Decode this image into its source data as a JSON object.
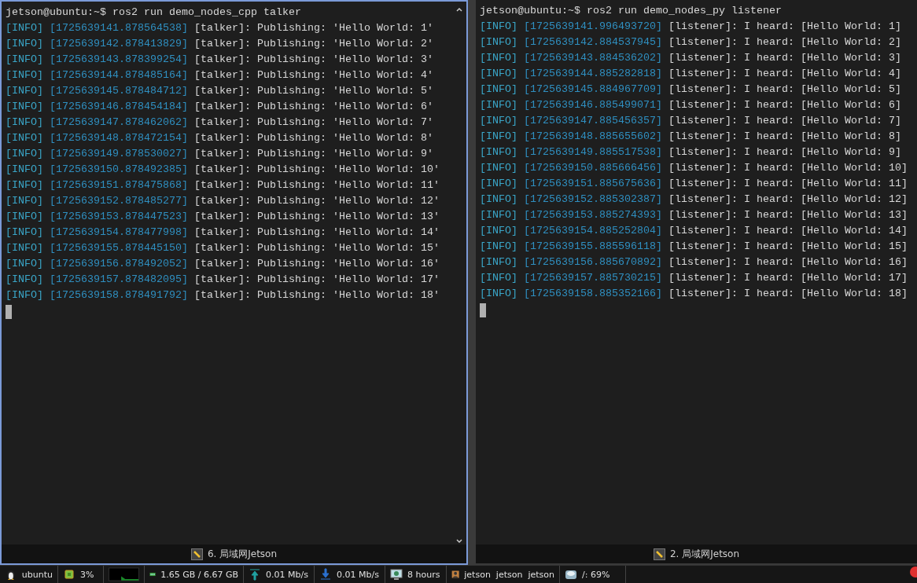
{
  "panes": [
    {
      "active": true,
      "prompt": "jetson@ubuntu:~$ ros2 run demo_nodes_cpp talker",
      "title": "6. 局域网Jetson",
      "lines": [
        {
          "level": "[INFO]",
          "timestamp": "[1725639141.878564538]",
          "message": "[talker]: Publishing: 'Hello World: 1'"
        },
        {
          "level": "[INFO]",
          "timestamp": "[1725639142.878413829]",
          "message": "[talker]: Publishing: 'Hello World: 2'"
        },
        {
          "level": "[INFO]",
          "timestamp": "[1725639143.878399254]",
          "message": "[talker]: Publishing: 'Hello World: 3'"
        },
        {
          "level": "[INFO]",
          "timestamp": "[1725639144.878485164]",
          "message": "[talker]: Publishing: 'Hello World: 4'"
        },
        {
          "level": "[INFO]",
          "timestamp": "[1725639145.878484712]",
          "message": "[talker]: Publishing: 'Hello World: 5'"
        },
        {
          "level": "[INFO]",
          "timestamp": "[1725639146.878454184]",
          "message": "[talker]: Publishing: 'Hello World: 6'"
        },
        {
          "level": "[INFO]",
          "timestamp": "[1725639147.878462062]",
          "message": "[talker]: Publishing: 'Hello World: 7'"
        },
        {
          "level": "[INFO]",
          "timestamp": "[1725639148.878472154]",
          "message": "[talker]: Publishing: 'Hello World: 8'"
        },
        {
          "level": "[INFO]",
          "timestamp": "[1725639149.878530027]",
          "message": "[talker]: Publishing: 'Hello World: 9'"
        },
        {
          "level": "[INFO]",
          "timestamp": "[1725639150.878492385]",
          "message": "[talker]: Publishing: 'Hello World: 10'"
        },
        {
          "level": "[INFO]",
          "timestamp": "[1725639151.878475868]",
          "message": "[talker]: Publishing: 'Hello World: 11'"
        },
        {
          "level": "[INFO]",
          "timestamp": "[1725639152.878485277]",
          "message": "[talker]: Publishing: 'Hello World: 12'"
        },
        {
          "level": "[INFO]",
          "timestamp": "[1725639153.878447523]",
          "message": "[talker]: Publishing: 'Hello World: 13'"
        },
        {
          "level": "[INFO]",
          "timestamp": "[1725639154.878477998]",
          "message": "[talker]: Publishing: 'Hello World: 14'"
        },
        {
          "level": "[INFO]",
          "timestamp": "[1725639155.878445150]",
          "message": "[talker]: Publishing: 'Hello World: 15'"
        },
        {
          "level": "[INFO]",
          "timestamp": "[1725639156.878492052]",
          "message": "[talker]: Publishing: 'Hello World: 16'"
        },
        {
          "level": "[INFO]",
          "timestamp": "[1725639157.878482095]",
          "message": "[talker]: Publishing: 'Hello World: 17'"
        },
        {
          "level": "[INFO]",
          "timestamp": "[1725639158.878491792]",
          "message": "[talker]: Publishing: 'Hello World: 18'"
        }
      ]
    },
    {
      "active": false,
      "prompt": "jetson@ubuntu:~$ ros2 run demo_nodes_py listener",
      "title": "2. 局域网Jetson",
      "lines": [
        {
          "level": "[INFO]",
          "timestamp": "[1725639141.996493720]",
          "message": "[listener]: I heard: [Hello World: 1]"
        },
        {
          "level": "[INFO]",
          "timestamp": "[1725639142.884537945]",
          "message": "[listener]: I heard: [Hello World: 2]"
        },
        {
          "level": "[INFO]",
          "timestamp": "[1725639143.884536202]",
          "message": "[listener]: I heard: [Hello World: 3]"
        },
        {
          "level": "[INFO]",
          "timestamp": "[1725639144.885282818]",
          "message": "[listener]: I heard: [Hello World: 4]"
        },
        {
          "level": "[INFO]",
          "timestamp": "[1725639145.884967709]",
          "message": "[listener]: I heard: [Hello World: 5]"
        },
        {
          "level": "[INFO]",
          "timestamp": "[1725639146.885499071]",
          "message": "[listener]: I heard: [Hello World: 6]"
        },
        {
          "level": "[INFO]",
          "timestamp": "[1725639147.885456357]",
          "message": "[listener]: I heard: [Hello World: 7]"
        },
        {
          "level": "[INFO]",
          "timestamp": "[1725639148.885655602]",
          "message": "[listener]: I heard: [Hello World: 8]"
        },
        {
          "level": "[INFO]",
          "timestamp": "[1725639149.885517538]",
          "message": "[listener]: I heard: [Hello World: 9]"
        },
        {
          "level": "[INFO]",
          "timestamp": "[1725639150.885666456]",
          "message": "[listener]: I heard: [Hello World: 10]"
        },
        {
          "level": "[INFO]",
          "timestamp": "[1725639151.885675636]",
          "message": "[listener]: I heard: [Hello World: 11]"
        },
        {
          "level": "[INFO]",
          "timestamp": "[1725639152.885302387]",
          "message": "[listener]: I heard: [Hello World: 12]"
        },
        {
          "level": "[INFO]",
          "timestamp": "[1725639153.885274393]",
          "message": "[listener]: I heard: [Hello World: 13]"
        },
        {
          "level": "[INFO]",
          "timestamp": "[1725639154.885252804]",
          "message": "[listener]: I heard: [Hello World: 14]"
        },
        {
          "level": "[INFO]",
          "timestamp": "[1725639155.885596118]",
          "message": "[listener]: I heard: [Hello World: 15]"
        },
        {
          "level": "[INFO]",
          "timestamp": "[1725639156.885670892]",
          "message": "[listener]: I heard: [Hello World: 16]"
        },
        {
          "level": "[INFO]",
          "timestamp": "[1725639157.885730215]",
          "message": "[listener]: I heard: [Hello World: 17]"
        },
        {
          "level": "[INFO]",
          "timestamp": "[1725639158.885352166]",
          "message": "[listener]: I heard: [Hello World: 18]"
        }
      ]
    }
  ],
  "taskbar": [
    {
      "kind": "os",
      "text": "ubuntu"
    },
    {
      "kind": "cpu",
      "text": "3%"
    },
    {
      "kind": "graph"
    },
    {
      "kind": "ram",
      "text": "1.65 GB / 6.67 GB"
    },
    {
      "kind": "upload",
      "text": "0.01 Mb/s"
    },
    {
      "kind": "download",
      "text": "0.01 Mb/s"
    },
    {
      "kind": "uptime",
      "text": "8 hours"
    },
    {
      "kind": "user",
      "text": "jetson  jetson  jetson"
    },
    {
      "kind": "disk",
      "text": "/: 69%"
    }
  ]
}
